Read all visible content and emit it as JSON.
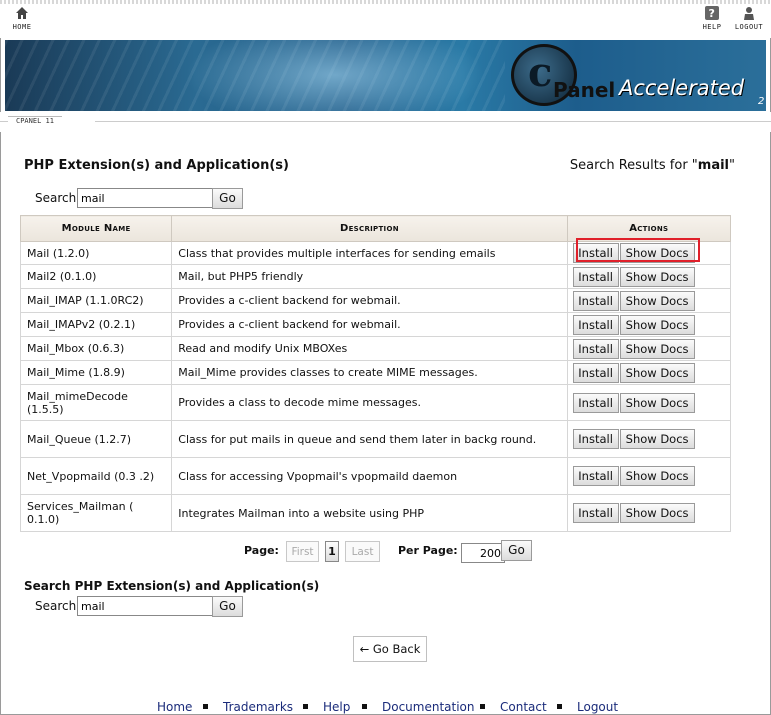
{
  "topbar": {
    "home_label": "HOME",
    "help_label": "HELP",
    "logout_label": "LOGOUT"
  },
  "banner": {
    "logo_c": "c",
    "logo_panel": "Panel",
    "logo_accelerated": "Accelerated",
    "logo_version": "2"
  },
  "subnav": {
    "tag": "CPANEL 11"
  },
  "main": {
    "title": "PHP Extension(s) and Application(s)",
    "results_prefix": "Search Results for \"",
    "results_term": "mail",
    "results_suffix": "\""
  },
  "search_top": {
    "label": "Search",
    "value": "mail",
    "go_label": "Go"
  },
  "table": {
    "headers": [
      "Module Name",
      "Description",
      "Actions"
    ],
    "install_label": "Install",
    "docs_label": "Show Docs",
    "rows": [
      {
        "name": "Mail (1.2.0)",
        "desc": "Class that provides multiple interfaces for sending emails"
      },
      {
        "name": "Mail2 (0.1.0)",
        "desc": "Mail, but PHP5 friendly"
      },
      {
        "name": "Mail_IMAP (1.1.0RC2)",
        "desc": "Provides a c-client backend for webmail."
      },
      {
        "name": "Mail_IMAPv2 (0.2.1)",
        "desc": "Provides a c-client backend for webmail."
      },
      {
        "name": "Mail_Mbox (0.6.3)",
        "desc": "Read and modify Unix MBOXes"
      },
      {
        "name": "Mail_Mime (1.8.9)",
        "desc": "Mail_Mime provides classes to create MIME messages."
      },
      {
        "name": "Mail_mimeDecode (1.5.5)",
        "desc": "Provides a class to decode mime messages."
      },
      {
        "name": "Mail_Queue (1.2.7)",
        "desc": "Class for put mails in queue and send them later in backg round."
      },
      {
        "name": "Net_Vpopmaild (0.3 .2)",
        "desc": "Class for accessing Vpopmail's vpopmaild daemon"
      },
      {
        "name": "Services_Mailman ( 0.1.0)",
        "desc": "Integrates Mailman into a website using PHP"
      }
    ]
  },
  "pagination": {
    "page_label": "Page:",
    "first_label": "First",
    "current_page": "1",
    "last_label": "Last",
    "per_page_label": "Per Page:",
    "per_page_value": "200",
    "go_label": "Go"
  },
  "search_bottom": {
    "title": "Search PHP Extension(s) and Application(s)",
    "label": "Search",
    "value": "mail",
    "go_label": "Go"
  },
  "go_back_label": "← Go Back",
  "footer": {
    "links": [
      "Home",
      "Trademarks",
      "Help",
      "Documentation",
      "Contact",
      "Logout"
    ]
  },
  "colors": {
    "highlight_border": "#e0202a",
    "footer_link": "#1a2b7a",
    "table_header_bg": "#ebe5dc"
  }
}
